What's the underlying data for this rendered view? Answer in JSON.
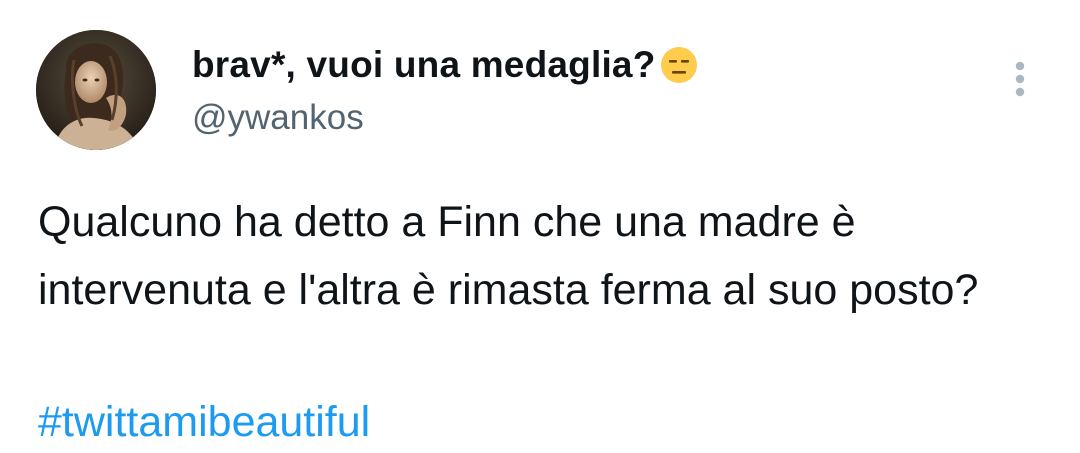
{
  "tweet": {
    "author": {
      "display_name": "brav*, vuoi una medaglia?",
      "emoji_icon": "expressionless-face-emoji",
      "handle": "@ywankos",
      "avatar_icon": "painting-portrait-avatar"
    },
    "menu_icon": "more-vertical-icon",
    "text": "Qualcuno ha detto a Finn che una madre è intervenuta e l'altra è rimasta ferma al suo posto?",
    "hashtag": "#twittamibeautiful",
    "colors": {
      "text": "#0f1419",
      "secondary": "#536471",
      "link": "#1d9bf0",
      "background": "#ffffff"
    }
  }
}
